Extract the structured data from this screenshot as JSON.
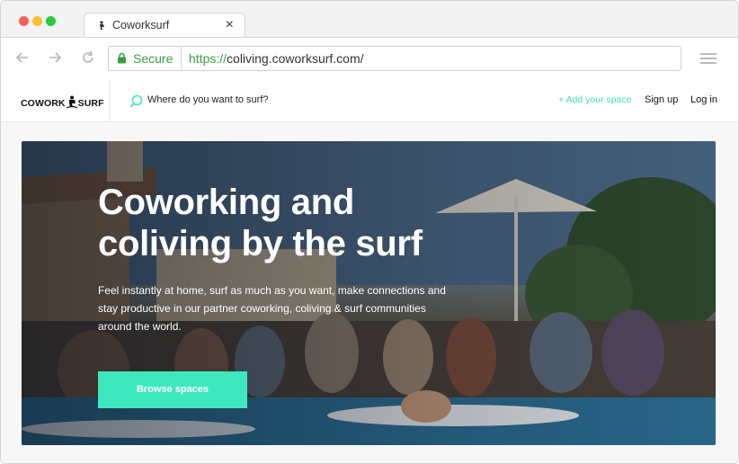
{
  "browser": {
    "tab_title": "Coworksurf",
    "security_label": "Secure",
    "url_scheme": "https://",
    "url_rest": "coliving.coworksurf.com/"
  },
  "header": {
    "logo_left": "COWORK",
    "logo_right": "SURF",
    "search_placeholder": "Where do you want to surf?",
    "add_space": "+ Add your space",
    "signup": "Sign up",
    "login": "Log in"
  },
  "hero": {
    "title_line1": "Coworking and",
    "title_line2": "coliving by the surf",
    "subtitle": "Feel instantly at home, surf as much as you want, make connections and stay productive in our partner coworking, coliving & surf communities around the world.",
    "cta": "Browse spaces"
  },
  "colors": {
    "accent": "#3ee8bf",
    "secure_green": "#3a9e3f"
  }
}
